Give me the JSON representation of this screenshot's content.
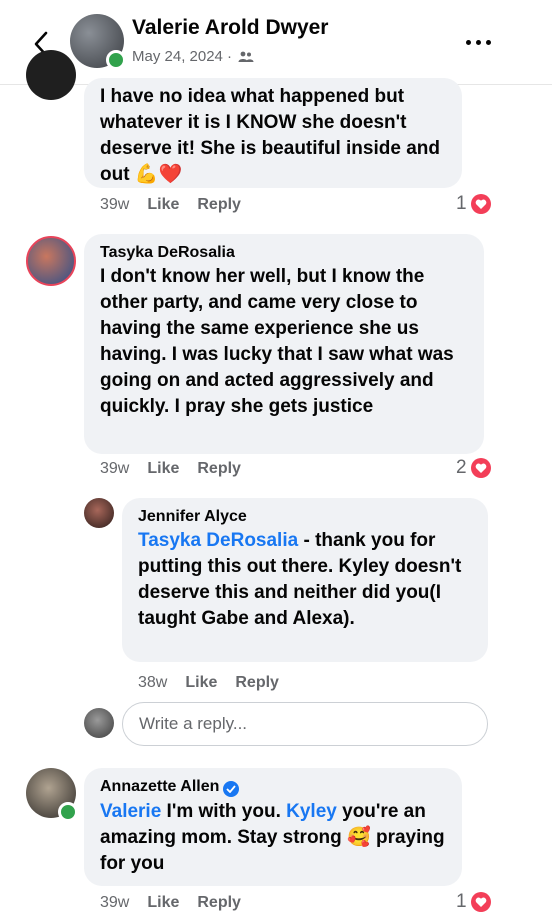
{
  "header": {
    "author": "Valerie Arold Dwyer",
    "date": "May 24, 2024 ·",
    "audience_icon": "friends-icon",
    "back_icon": "chevron-left-icon",
    "more_icon": "more-horizontal-icon"
  },
  "comments": [
    {
      "author": "",
      "text": "I have no idea what happened but whatever it is I KNOW she doesn't deserve it! She is beautiful inside and out 💪❤️",
      "time": "39w",
      "like": "Like",
      "reply": "Reply",
      "reactions": "1"
    },
    {
      "author": "Tasyka DeRosalia",
      "text": "I don't know her well, but I know the other party, and came very close to having the same experience she us having.  I was lucky that I saw what was going on and acted aggressively and quickly. I pray she gets justice",
      "time": "39w",
      "like": "Like",
      "reply": "Reply",
      "reactions": "2"
    },
    {
      "author": "Jennifer Alyce",
      "mention": "Tasyka DeRosalia",
      "text": " - thank you for putting this out there. Kyley doesn't deserve this and neither did you(I taught Gabe and Alexa).",
      "time": "38w",
      "like": "Like",
      "reply": "Reply"
    },
    {
      "author": "Annazette Allen",
      "mention1": "Valerie",
      "text1": " I'm with you.  ",
      "mention2": "Kyley",
      "text2": " you're an amazing mom. Stay strong 🥰 praying for you",
      "time": "39w",
      "like": "Like",
      "reply": "Reply",
      "reactions": "1"
    }
  ],
  "reply_input": {
    "placeholder": "Write a reply..."
  },
  "colors": {
    "accent": "#1877f2",
    "bubble": "#f0f2f5",
    "heart": "#f33e58",
    "online": "#31a24c"
  }
}
